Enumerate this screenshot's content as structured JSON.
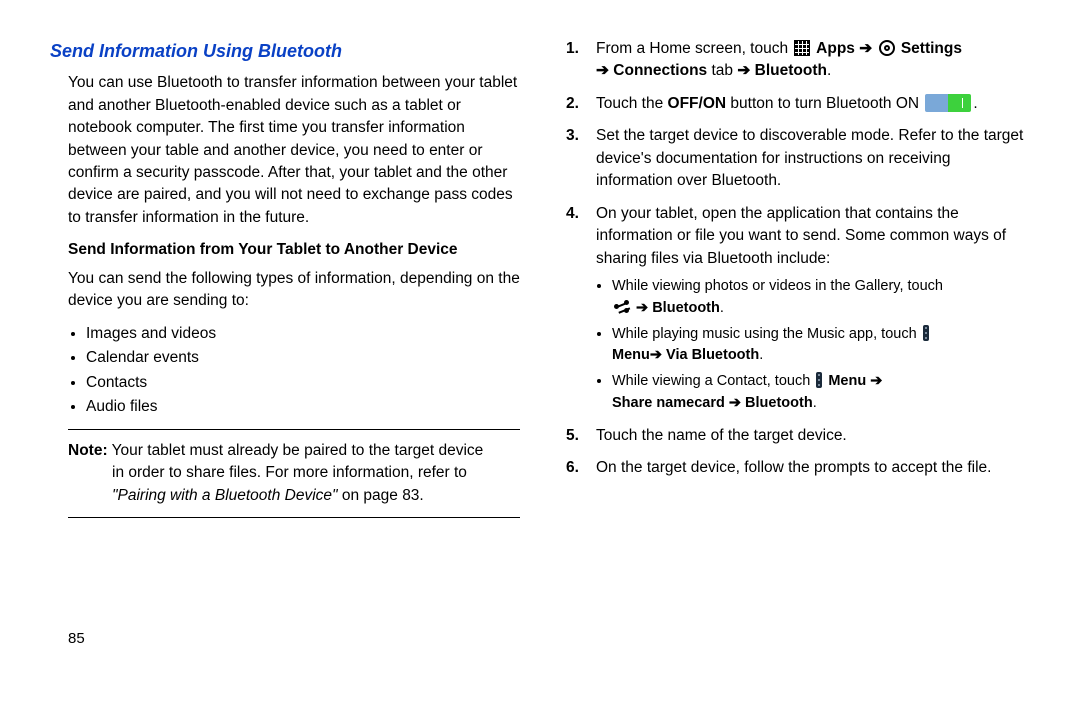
{
  "left": {
    "title": "Send Information Using Bluetooth",
    "intro": "You can use Bluetooth to transfer information between your tablet and another Bluetooth-enabled device such as a tablet or notebook computer. The first time you transfer information between your table and another device, you need to enter or confirm a security passcode. After that, your tablet and the other device are paired, and you will not need to exchange pass codes to transfer information in the future.",
    "subhead": "Send Information from Your Tablet to Another Device",
    "send_intro": "You can send the following types of information, depending on the device you are sending to:",
    "items": {
      "a": "Images and videos",
      "b": "Calendar events",
      "c": "Contacts",
      "d": "Audio files"
    },
    "note_label": "Note:",
    "note_line1": " Your tablet must already be paired to the target device",
    "note_line2": "in order to share files. For more information, refer to",
    "note_ref_italic": "\"Pairing with a Bluetooth Device\"",
    "note_ref_plain": " on page 83.",
    "page_num": "85"
  },
  "right": {
    "s1a": "From a Home screen, touch ",
    "s1_apps": " Apps",
    "s1_arrow1": " ➔ ",
    "s1_settings": " Settings",
    "s1_arrow2": "➔ Connections",
    "s1_tab": " tab ",
    "s1_arrow3": "➔ Bluetooth",
    "s1_period": ".",
    "s2a": "Touch the ",
    "s2_offon": "OFF/ON",
    "s2b": " button to turn Bluetooth ON ",
    "s2_period": ".",
    "s3": "Set the target device to discoverable mode. Refer to the target device's documentation for instructions on receiving information over Bluetooth.",
    "s4": "On your tablet, open the application that contains the information or file you want to send. Some common ways of sharing files via Bluetooth include:",
    "sb1a": "While viewing photos or videos in the Gallery, touch ",
    "sb1_bt": " ➔ Bluetooth",
    "sb1_period": ".",
    "sb2a": "While playing music using the Music app, touch ",
    "sb2_menu": "Menu➔  Via Bluetooth",
    "sb2_period": ".",
    "sb3a": "While viewing a Contact, touch ",
    "sb3_menu": " Menu ",
    "sb3_arrow": "➔",
    "sb3_share": "Share namecard ➔ Bluetooth",
    "sb3_period": ".",
    "s5": "Touch the name of the target device.",
    "s6": "On the target device, follow the prompts to accept the file."
  }
}
